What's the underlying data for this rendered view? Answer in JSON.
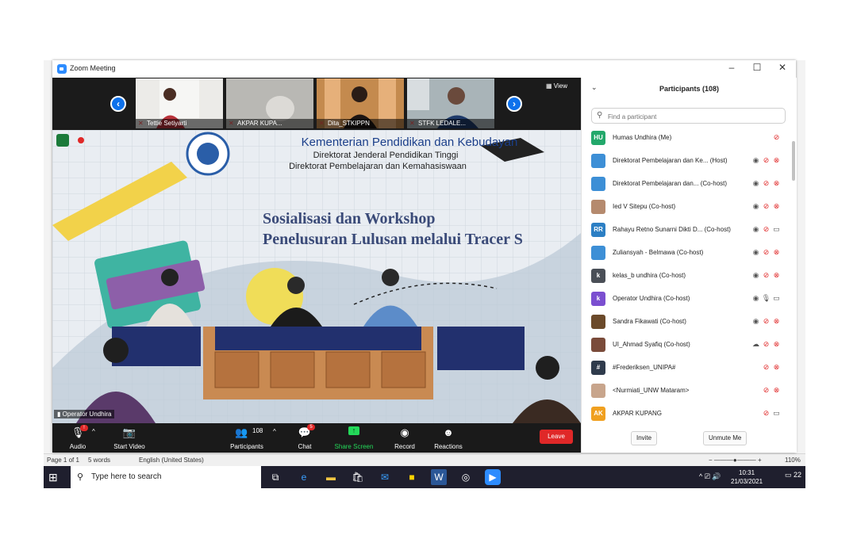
{
  "window": {
    "title": "Zoom Meeting",
    "minimize": "–",
    "maximize": "☐",
    "close": "✕"
  },
  "gallery": {
    "view_label": "View",
    "tiles": [
      {
        "name": "Tettie Setiyarti"
      },
      {
        "name": "AKPAR KUPA..."
      },
      {
        "name": "Dita_STKIPPN"
      },
      {
        "name": "STFK LEDALE..."
      }
    ]
  },
  "main_video": {
    "banner_line1": "Kementerian Pendidikan dan Kebudayan",
    "banner_line2": "Direktorat Jenderal Pendidikan Tinggi",
    "banner_line3": "Direktorat Pembelajaran dan Kemahasiswaan",
    "title_line1": "Sosialisasi dan Workshop",
    "title_line2": "Penelusuran Lulusan melalui Tracer S",
    "speaker_label": "Operator Undhira"
  },
  "toolbar": {
    "audio_label": "Audio",
    "audio_badge": "!",
    "video_label": "Start Video",
    "participants_label": "Participants",
    "participants_count": "108",
    "chat_label": "Chat",
    "chat_badge": "5",
    "share_label": "Share Screen",
    "record_label": "Record",
    "reactions_label": "Reactions",
    "leave_label": "Leave",
    "colors": {
      "share": "#23d959",
      "leave": "#e02828",
      "bar": "#1a1a1a"
    }
  },
  "participants_panel": {
    "title": "Participants (108)",
    "search_placeholder": "Find a participant",
    "invite_label": "Invite",
    "unmute_label": "Unmute Me",
    "rows": [
      {
        "avatar": "HU",
        "color": "#23a86b",
        "name": "Humas Undhira (Me)",
        "icons": [
          "mic-muted"
        ]
      },
      {
        "avatar": "",
        "color": "#3d8fd6",
        "name": "Direktorat Pembelajaran dan Ke... (Host)",
        "icons": [
          "spotlight",
          "mic-muted",
          "video-off"
        ]
      },
      {
        "avatar": "",
        "color": "#3d8fd6",
        "name": "Direktorat Pembelajaran dan... (Co-host)",
        "icons": [
          "spotlight",
          "mic-muted",
          "video-off"
        ]
      },
      {
        "avatar": "",
        "color": "#b58a6e",
        "name": "Ied V Sitepu (Co-host)",
        "icons": [
          "spotlight",
          "mic-muted",
          "video-off"
        ]
      },
      {
        "avatar": "RR",
        "color": "#2c7fc4",
        "name": "Rahayu Retno Sunarni Dikti D... (Co-host)",
        "icons": [
          "spotlight",
          "mic-muted",
          "video-on"
        ]
      },
      {
        "avatar": "",
        "color": "#3d8fd6",
        "name": "Zuliansyah - Belmawa (Co-host)",
        "icons": [
          "spotlight",
          "mic-muted",
          "video-off"
        ]
      },
      {
        "avatar": "k",
        "color": "#4a4f57",
        "name": "kelas_b undhira (Co-host)",
        "icons": [
          "spotlight",
          "mic-muted",
          "video-off"
        ]
      },
      {
        "avatar": "k",
        "color": "#7b4fd0",
        "name": "Operator Undhira (Co-host)",
        "icons": [
          "spotlight",
          "mic-on",
          "video-on"
        ]
      },
      {
        "avatar": "",
        "color": "#6b4a2a",
        "name": "Sandra Fikawati (Co-host)",
        "icons": [
          "spotlight",
          "mic-muted",
          "video-off"
        ]
      },
      {
        "avatar": "",
        "color": "#7a4b3a",
        "name": "UI_Ahmad Syafiq (Co-host)",
        "icons": [
          "cloud",
          "mic-muted",
          "video-off"
        ]
      },
      {
        "avatar": "#",
        "color": "#2f3b4c",
        "name": "#Frederiksen_UNIPA#",
        "icons": [
          "mic-muted",
          "video-off"
        ]
      },
      {
        "avatar": "",
        "color": "#c8a58c",
        "name": "<Nurmiati_UNW Mataram>",
        "icons": [
          "mic-muted",
          "video-off"
        ]
      },
      {
        "avatar": "AK",
        "color": "#f0a020",
        "name": "AKPAR KUPANG",
        "icons": [
          "mic-muted",
          "video-on"
        ]
      }
    ]
  },
  "word_status": {
    "page": "Page 1 of 1",
    "words": "5 words",
    "lang": "English (United States)",
    "zoom": "110%"
  },
  "taskbar": {
    "search_placeholder": "Type here to search",
    "time": "10:31",
    "date": "21/03/2021",
    "notifications": "22"
  }
}
